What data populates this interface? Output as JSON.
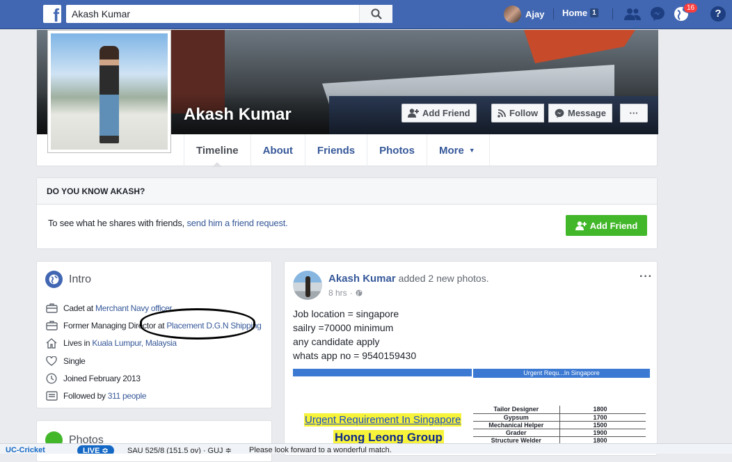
{
  "topbar": {
    "search_value": "Akash Kumar",
    "user_name": "Ajay",
    "home_label": "Home",
    "home_badge": "1",
    "notifications_count": "16",
    "help_label": "?"
  },
  "profile": {
    "name": "Akash Kumar",
    "buttons": {
      "add_friend": "Add Friend",
      "follow": "Follow",
      "message": "Message",
      "more": "···"
    },
    "tabs": [
      "Timeline",
      "About",
      "Friends",
      "Photos",
      "More"
    ],
    "active_tab": "Timeline"
  },
  "know_card": {
    "heading": "DO YOU KNOW AKASH?",
    "text_prefix": "To see what he shares with friends, ",
    "link_text": "send him a friend request.",
    "add_friend": "Add Friend"
  },
  "intro": {
    "title": "Intro",
    "rows": [
      {
        "icon": "briefcase-icon",
        "prefix": "Cadet at ",
        "link": "Merchant Navy officer"
      },
      {
        "icon": "briefcase-icon",
        "prefix": "Former Managing Director at ",
        "link": "Placement D.G.N Shipping"
      },
      {
        "icon": "home-icon",
        "prefix": "Lives in ",
        "link": "Kuala Lumpur, Malaysia"
      },
      {
        "icon": "heart-icon",
        "prefix": "Single",
        "link": ""
      },
      {
        "icon": "clock-icon",
        "prefix": "Joined February 2013",
        "link": ""
      },
      {
        "icon": "followers-icon",
        "prefix": "Followed by ",
        "link": "311 people"
      }
    ]
  },
  "photos_card": {
    "title": "Photos"
  },
  "post": {
    "author": "Akash Kumar",
    "action": " added ",
    "action_link": "2 new photos",
    "action_suffix": ".",
    "time": "8 hrs",
    "lines": [
      "Job location = singapore",
      "sailry =70000 minimum",
      "any candidate apply",
      "whats app no = 9540159430"
    ],
    "image1": {
      "line1": "Urgent Requirement In Singapore",
      "line2": "Hong Leong Group"
    },
    "image2": {
      "header": "Urgent Requ...In Singapore",
      "rows": [
        [
          "Tailor Designer",
          "1800"
        ],
        [
          "Gypsum",
          "1700"
        ],
        [
          "Mechanical Helper",
          "1500"
        ],
        [
          "Grader",
          "1900"
        ],
        [
          "Structure Welder",
          "1800"
        ]
      ]
    }
  },
  "taskbar": {
    "app": "UC-Cricket",
    "live": "LIVE ≎",
    "score": "SAU 525/8 (151.5 ov) · GUJ ≑",
    "message": "Please look forward to a wonderful match."
  },
  "colors": {
    "brand": "#4267b2",
    "link": "#365899",
    "green": "#42b72a",
    "highlight": "#f7f23a"
  }
}
